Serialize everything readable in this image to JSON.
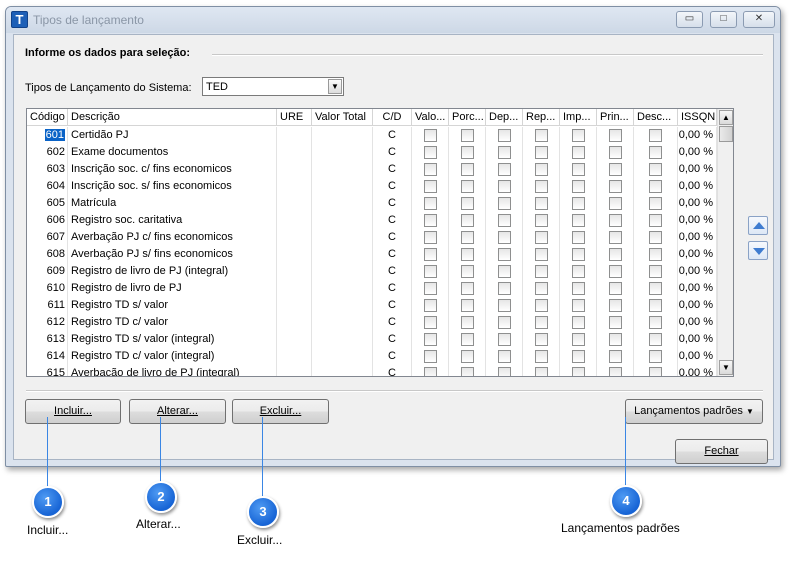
{
  "window": {
    "title": "Tipos de lançamento",
    "app_icon_letter": "T"
  },
  "selection": {
    "group_title": "Informe os dados para seleção:",
    "system_label": "Tipos de Lançamento do Sistema:",
    "system_value": "TED"
  },
  "grid": {
    "columns": [
      "Código",
      "Descrição",
      "URE",
      "Valor Total",
      "C/D",
      "Valo...",
      "Porc...",
      "Dep...",
      "Rep...",
      "Imp...",
      "Prin...",
      "Desc...",
      "ISSQN"
    ],
    "rows": [
      {
        "code": "601",
        "desc": "Certidão PJ",
        "cd": "C",
        "issqn": "0,00 %"
      },
      {
        "code": "602",
        "desc": "Exame documentos",
        "cd": "C",
        "issqn": "0,00 %"
      },
      {
        "code": "603",
        "desc": "Inscrição soc. c/ fins economicos",
        "cd": "C",
        "issqn": "0,00 %"
      },
      {
        "code": "604",
        "desc": "Inscrição soc. s/ fins economicos",
        "cd": "C",
        "issqn": "0,00 %"
      },
      {
        "code": "605",
        "desc": "Matrícula",
        "cd": "C",
        "issqn": "0,00 %"
      },
      {
        "code": "606",
        "desc": "Registro soc. caritativa",
        "cd": "C",
        "issqn": "0,00 %"
      },
      {
        "code": "607",
        "desc": "Averbação PJ c/ fins economicos",
        "cd": "C",
        "issqn": "0,00 %"
      },
      {
        "code": "608",
        "desc": "Averbação PJ s/ fins economicos",
        "cd": "C",
        "issqn": "0,00 %"
      },
      {
        "code": "609",
        "desc": "Registro de livro de PJ (integral)",
        "cd": "C",
        "issqn": "0,00 %"
      },
      {
        "code": "610",
        "desc": "Registro de livro de PJ",
        "cd": "C",
        "issqn": "0,00 %"
      },
      {
        "code": "611",
        "desc": "Registro TD s/ valor",
        "cd": "C",
        "issqn": "0,00 %"
      },
      {
        "code": "612",
        "desc": "Registro TD c/ valor",
        "cd": "C",
        "issqn": "0,00 %"
      },
      {
        "code": "613",
        "desc": "Registro TD s/ valor (integral)",
        "cd": "C",
        "issqn": "0,00 %"
      },
      {
        "code": "614",
        "desc": "Registro TD c/ valor (integral)",
        "cd": "C",
        "issqn": "0,00 %"
      },
      {
        "code": "615",
        "desc": "Averbação de livro de PJ (integral)",
        "cd": "C",
        "issqn": "0,00 %"
      }
    ]
  },
  "buttons": {
    "incluir": "Incluir...",
    "alterar": "Alterar...",
    "excluir": "Excluir...",
    "lancamentos": "Lançamentos padrões",
    "fechar": "Fechar"
  },
  "callouts": [
    {
      "number": "1",
      "label": "Incluir..."
    },
    {
      "number": "2",
      "label": "Alterar..."
    },
    {
      "number": "3",
      "label": "Excluir..."
    },
    {
      "number": "4",
      "label": "Lançamentos padrões"
    }
  ],
  "colors": {
    "accent": "#1764d5",
    "selection": "#0a63c7"
  },
  "icons": [
    "app-icon",
    "minimize-icon",
    "maximize-icon",
    "close-icon",
    "dropdown-arrow-icon",
    "scroll-up-icon",
    "scroll-down-icon",
    "move-up-icon",
    "move-down-icon"
  ]
}
